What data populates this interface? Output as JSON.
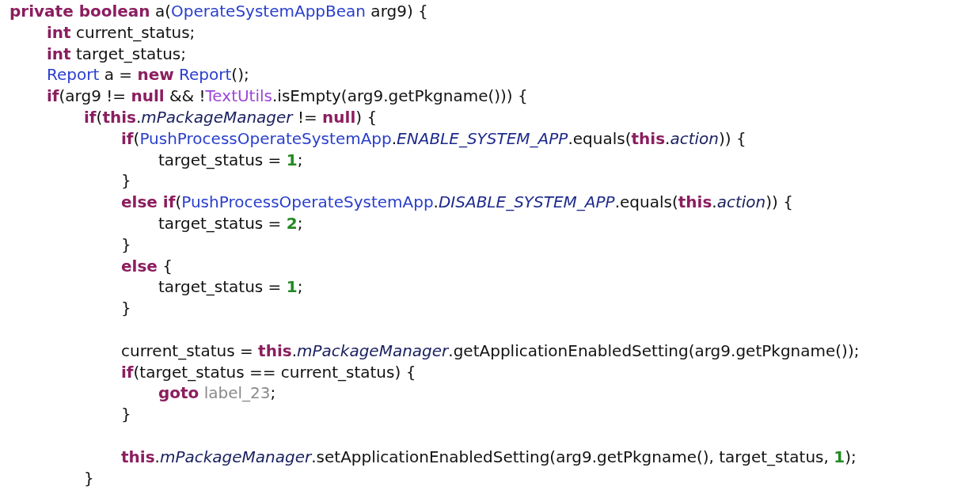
{
  "code": [
    {
      "kind": "code",
      "tokens": [
        {
          "kind": "keyword",
          "text": "private boolean"
        },
        {
          "kind": "plain",
          "text": " a("
        },
        {
          "kind": "type",
          "text": "OperateSystemAppBean"
        },
        {
          "kind": "plain",
          "text": " arg9) {"
        }
      ],
      "children": [
        {
          "kind": "code",
          "tokens": [
            {
              "kind": "keyword",
              "text": "int"
            },
            {
              "kind": "plain",
              "text": " current_status;"
            }
          ]
        },
        {
          "kind": "code",
          "tokens": [
            {
              "kind": "keyword",
              "text": "int"
            },
            {
              "kind": "plain",
              "text": " target_status;"
            }
          ]
        },
        {
          "kind": "code",
          "tokens": [
            {
              "kind": "type",
              "text": "Report"
            },
            {
              "kind": "plain",
              "text": " a = "
            },
            {
              "kind": "keyword",
              "text": "new"
            },
            {
              "kind": "type",
              "text": " Report"
            },
            {
              "kind": "plain",
              "text": "();"
            }
          ]
        },
        {
          "kind": "code",
          "tokens": [
            {
              "kind": "keyword",
              "text": "if"
            },
            {
              "kind": "plain",
              "text": "(arg9 != "
            },
            {
              "kind": "keyword",
              "text": "null"
            },
            {
              "kind": "plain",
              "text": " && !"
            },
            {
              "kind": "util",
              "text": "TextUtils"
            },
            {
              "kind": "plain",
              "text": ".isEmpty(arg9.getPkgname())) {"
            }
          ],
          "children": [
            {
              "kind": "code",
              "tokens": [
                {
                  "kind": "keyword",
                  "text": "if"
                },
                {
                  "kind": "plain",
                  "text": "("
                },
                {
                  "kind": "keyword",
                  "text": "this"
                },
                {
                  "kind": "plain",
                  "text": "."
                },
                {
                  "kind": "field",
                  "text": "mPackageManager"
                },
                {
                  "kind": "plain",
                  "text": " != "
                },
                {
                  "kind": "keyword",
                  "text": "null"
                },
                {
                  "kind": "plain",
                  "text": ") {"
                }
              ],
              "children": [
                {
                  "kind": "code",
                  "tokens": [
                    {
                      "kind": "keyword",
                      "text": "if"
                    },
                    {
                      "kind": "plain",
                      "text": "("
                    },
                    {
                      "kind": "type",
                      "text": "PushProcessOperateSystemApp"
                    },
                    {
                      "kind": "plain",
                      "text": "."
                    },
                    {
                      "kind": "constant",
                      "text": "ENABLE_SYSTEM_APP"
                    },
                    {
                      "kind": "plain",
                      "text": ".equals("
                    },
                    {
                      "kind": "keyword",
                      "text": "this"
                    },
                    {
                      "kind": "plain",
                      "text": "."
                    },
                    {
                      "kind": "field",
                      "text": "action"
                    },
                    {
                      "kind": "plain",
                      "text": ")) {"
                    }
                  ],
                  "children": [
                    {
                      "kind": "code",
                      "tokens": [
                        {
                          "kind": "plain",
                          "text": "target_status = "
                        },
                        {
                          "kind": "number",
                          "text": "1"
                        },
                        {
                          "kind": "plain",
                          "text": ";"
                        }
                      ]
                    }
                  ]
                },
                {
                  "kind": "code",
                  "tokens": [
                    {
                      "kind": "plain",
                      "text": "}"
                    }
                  ]
                },
                {
                  "kind": "code",
                  "tokens": [
                    {
                      "kind": "keyword",
                      "text": "else if"
                    },
                    {
                      "kind": "plain",
                      "text": "("
                    },
                    {
                      "kind": "type",
                      "text": "PushProcessOperateSystemApp"
                    },
                    {
                      "kind": "plain",
                      "text": "."
                    },
                    {
                      "kind": "constant",
                      "text": "DISABLE_SYSTEM_APP"
                    },
                    {
                      "kind": "plain",
                      "text": ".equals("
                    },
                    {
                      "kind": "keyword",
                      "text": "this"
                    },
                    {
                      "kind": "plain",
                      "text": "."
                    },
                    {
                      "kind": "field",
                      "text": "action"
                    },
                    {
                      "kind": "plain",
                      "text": ")) {"
                    }
                  ],
                  "children": [
                    {
                      "kind": "code",
                      "tokens": [
                        {
                          "kind": "plain",
                          "text": "target_status = "
                        },
                        {
                          "kind": "number",
                          "text": "2"
                        },
                        {
                          "kind": "plain",
                          "text": ";"
                        }
                      ]
                    }
                  ]
                },
                {
                  "kind": "code",
                  "tokens": [
                    {
                      "kind": "plain",
                      "text": "}"
                    }
                  ]
                },
                {
                  "kind": "code",
                  "tokens": [
                    {
                      "kind": "keyword",
                      "text": "else"
                    },
                    {
                      "kind": "plain",
                      "text": " {"
                    }
                  ],
                  "children": [
                    {
                      "kind": "code",
                      "tokens": [
                        {
                          "kind": "plain",
                          "text": "target_status = "
                        },
                        {
                          "kind": "number",
                          "text": "1"
                        },
                        {
                          "kind": "plain",
                          "text": ";"
                        }
                      ]
                    }
                  ]
                },
                {
                  "kind": "code",
                  "tokens": [
                    {
                      "kind": "plain",
                      "text": "}"
                    }
                  ]
                },
                {
                  "kind": "blank"
                },
                {
                  "kind": "code",
                  "tokens": [
                    {
                      "kind": "plain",
                      "text": "current_status = "
                    },
                    {
                      "kind": "keyword",
                      "text": "this"
                    },
                    {
                      "kind": "plain",
                      "text": "."
                    },
                    {
                      "kind": "field",
                      "text": "mPackageManager"
                    },
                    {
                      "kind": "plain",
                      "text": ".getApplicationEnabledSetting(arg9.getPkgname());"
                    }
                  ]
                },
                {
                  "kind": "code",
                  "tokens": [
                    {
                      "kind": "keyword",
                      "text": "if"
                    },
                    {
                      "kind": "plain",
                      "text": "(target_status == current_status) {"
                    }
                  ],
                  "children": [
                    {
                      "kind": "code",
                      "tokens": [
                        {
                          "kind": "keyword",
                          "text": "goto"
                        },
                        {
                          "kind": "label",
                          "text": " label_23"
                        },
                        {
                          "kind": "plain",
                          "text": ";"
                        }
                      ]
                    }
                  ]
                },
                {
                  "kind": "code",
                  "tokens": [
                    {
                      "kind": "plain",
                      "text": "}"
                    }
                  ]
                },
                {
                  "kind": "blank"
                },
                {
                  "kind": "code",
                  "tokens": [
                    {
                      "kind": "keyword",
                      "text": "this"
                    },
                    {
                      "kind": "plain",
                      "text": "."
                    },
                    {
                      "kind": "field",
                      "text": "mPackageManager"
                    },
                    {
                      "kind": "plain",
                      "text": ".setApplicationEnabledSetting(arg9.getPkgname(), target_status, "
                    },
                    {
                      "kind": "number",
                      "text": "1"
                    },
                    {
                      "kind": "plain",
                      "text": ");"
                    }
                  ]
                }
              ]
            },
            {
              "kind": "code",
              "tokens": [
                {
                  "kind": "plain",
                  "text": "}"
                }
              ]
            }
          ]
        }
      ]
    }
  ]
}
